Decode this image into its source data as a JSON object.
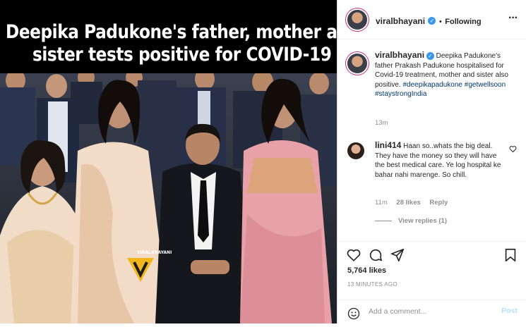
{
  "post_image": {
    "headline_line1": "Deepika Padukone's father, mother and",
    "headline_line2": "sister tests positive for COVID-19",
    "watermark_text": "VIRALBHAYANI"
  },
  "header": {
    "username": "viralbhayani",
    "separator": "•",
    "follow_status": "Following",
    "more_icon": "more-horizontal-icon"
  },
  "caption": {
    "username": "viralbhayani",
    "text": "Deepika Padukone's father Prakash Padukone hospitalised for Covid-19 treatment, mother and sister also positive.",
    "hashtags": "#deepikapadukone #getwellsoon #staystrongIndia",
    "time": "13m"
  },
  "comment": {
    "username": "lini414",
    "text": "Haan so..whats the big deal. They have the money so they will have the best medical care. Ye log hospital ke bahar nahi marenge. So chill.",
    "time": "11m",
    "likes": "28 likes",
    "reply": "Reply",
    "view_replies": "View replies (1)"
  },
  "actions": {
    "likes": "5,764 likes",
    "posted": "13 MINUTES AGO"
  },
  "add_comment": {
    "placeholder": "Add a comment...",
    "post_label": "Post"
  },
  "colors": {
    "verified": "#3897f0",
    "link": "#00376b",
    "post_disabled": "#b2dffc",
    "saree_pink": "#e8a1a8",
    "saree_cream": "#f1dcc7"
  }
}
